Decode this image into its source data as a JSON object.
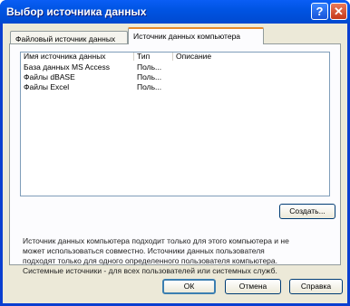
{
  "window": {
    "title": "Выбор источника данных",
    "help_glyph": "?",
    "close_glyph": "✕"
  },
  "tabs": [
    {
      "label": "Файловый источник данных"
    },
    {
      "label": "Источник данных компьютера"
    }
  ],
  "list": {
    "columns": [
      "Имя источника данных",
      "Тип",
      "Описание"
    ],
    "rows": [
      {
        "name": "База данных MS Access",
        "type": "Поль...",
        "desc": ""
      },
      {
        "name": "Файлы dBASE",
        "type": "Поль...",
        "desc": ""
      },
      {
        "name": "Файлы Excel",
        "type": "Поль...",
        "desc": ""
      }
    ]
  },
  "buttons": {
    "create": "Создать...",
    "ok": "ОК",
    "cancel": "Отмена",
    "help": "Справка"
  },
  "info": {
    "lines": [
      "Источник данных компьютера подходит только для этого компьютера и не",
      "может использоваться совместно.  Источники данных пользователя",
      "подходят только для одного определенного пользователя компьютера.",
      "Системные источники - для всех пользователей или системных служб."
    ]
  }
}
